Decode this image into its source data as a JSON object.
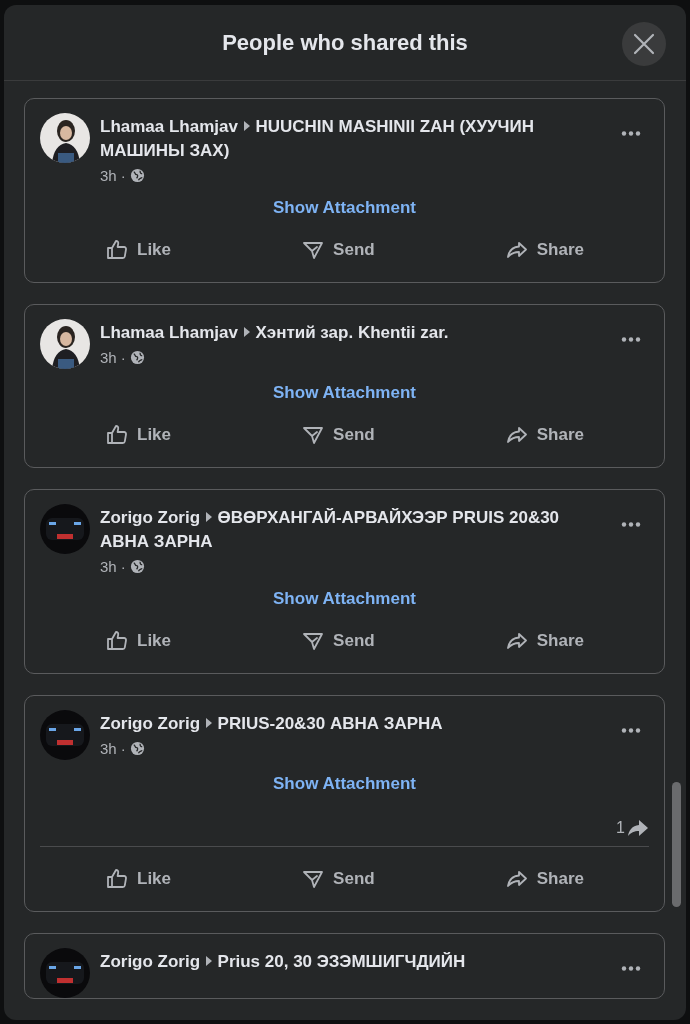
{
  "dialog": {
    "title": "People who shared this"
  },
  "posts": [
    {
      "kind": "portrait",
      "author": "Lhamaa Lhamjav",
      "target": "HUUCHIN MASHINII ZAH (ХУУЧИН МАШИНЫ ЗАХ)",
      "time": "3h ·",
      "attachment": "Show Attachment",
      "actions": [
        "Like",
        "Send",
        "Share"
      ]
    },
    {
      "kind": "portrait",
      "author": "Lhamaa Lhamjav",
      "target": "Хэнтий зар. Khentii zar.",
      "time": "3h ·",
      "attachment": "Show Attachment",
      "actions": [
        "Like",
        "Send",
        "Share"
      ]
    },
    {
      "kind": "car",
      "author": "Zorigo Zorig",
      "target": "ӨВӨРХАНГАЙ-АРВАЙХЭЭР PRUIS 20&30 АВНА ЗАРНА",
      "time": "3h ·",
      "attachment": "Show Attachment",
      "actions": [
        "Like",
        "Send",
        "Share"
      ]
    },
    {
      "kind": "car",
      "author": "Zorigo Zorig",
      "target": "PRIUS-20&30 АВНА ЗАРНА",
      "time": "3h ·",
      "attachment": "Show Attachment",
      "share_count": "1",
      "actions": [
        "Like",
        "Send",
        "Share"
      ]
    },
    {
      "kind": "car",
      "author": "Zorigo Zorig",
      "target": "Prius 20, 30 ЭЗЭМШИГЧДИЙН"
    }
  ]
}
